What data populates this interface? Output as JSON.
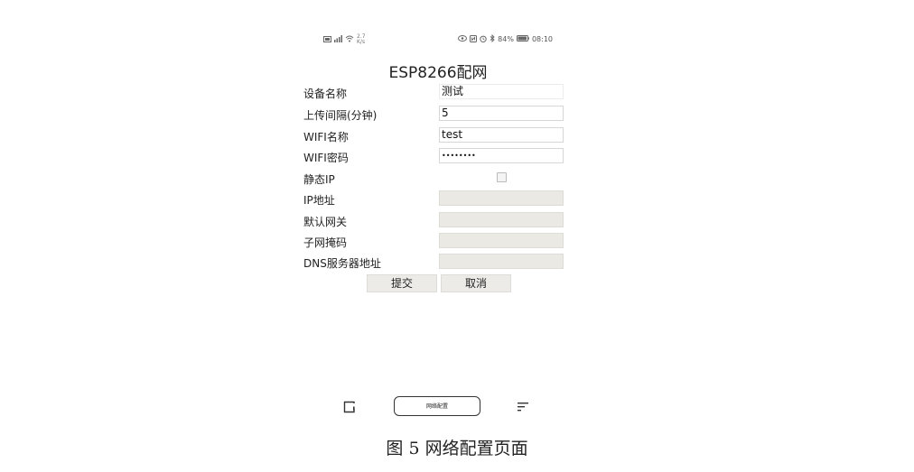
{
  "status_bar": {
    "left_icons": [
      "sim-icon",
      "signal-icon",
      "wifi-icon"
    ],
    "net_speed": "2.7\nK/s",
    "right_icons": [
      "eye-icon",
      "nfc-icon",
      "alarm-icon",
      "bluetooth-icon"
    ],
    "battery_percent": "84%",
    "time": "08:10"
  },
  "page": {
    "title": "ESP8266配网"
  },
  "form": {
    "device_name_label": "设备名称",
    "device_name_value": "测试",
    "upload_interval_label": "上传间隔(分钟)",
    "upload_interval_value": "5",
    "wifi_name_label": "WIFI名称",
    "wifi_name_value": "test",
    "wifi_password_label": "WIFI密码",
    "wifi_password_value": "••••••••",
    "static_ip_label": "静态IP",
    "static_ip_checked": false,
    "ip_label": "IP地址",
    "ip_value": "",
    "gateway_label": "默认网关",
    "gateway_value": "",
    "subnet_label": "子网掩码",
    "subnet_value": "",
    "dns_label": "DNS服务器地址",
    "dns_value": ""
  },
  "actions": {
    "submit_label": "提交",
    "cancel_label": "取消"
  },
  "nav_bar": {
    "center_label": "网络配置"
  },
  "caption": {
    "text": "图 5  网络配置页面"
  }
}
